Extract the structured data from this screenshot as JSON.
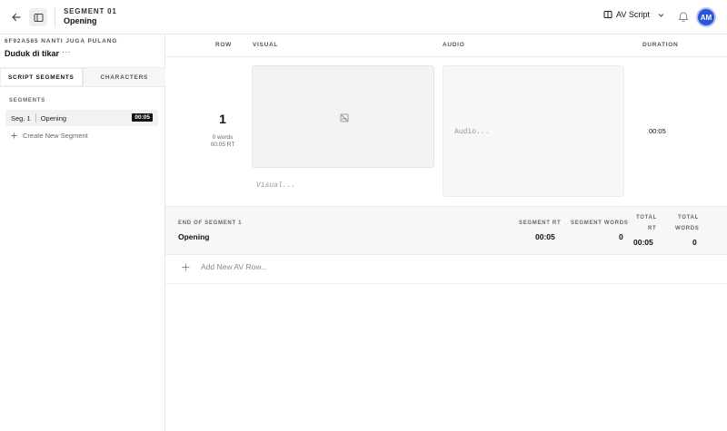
{
  "header": {
    "segment_eyebrow": "SEGMENT 01",
    "segment_title": "Opening",
    "view_label": "AV Script",
    "avatar_initials": "AM"
  },
  "sidebar": {
    "project_id": "6F92A585 NANTI JUGA PULANG",
    "project_name": "Duduk di tikar",
    "more_label": "···",
    "tabs": [
      {
        "label": "SCRIPT SEGMENTS",
        "active": true
      },
      {
        "label": "CHARACTERS",
        "active": false
      }
    ],
    "segments_heading": "SEGMENTS",
    "segments": [
      {
        "number": "Seg. 1",
        "title": "Opening",
        "duration": "00:05"
      }
    ],
    "create_label": "Create New Segment"
  },
  "table": {
    "columns": {
      "row": "ROW",
      "visual": "VISUAL",
      "audio": "AUDIO",
      "duration": "DURATION"
    },
    "rows": [
      {
        "number": "1",
        "words": "0 words",
        "rt": "00:05 RT",
        "visual_placeholder": "Visual...",
        "audio_placeholder": "Audio...",
        "duration": "00:05"
      }
    ]
  },
  "summary": {
    "end_label": "END OF SEGMENT 1",
    "segment_name": "Opening",
    "segment_rt_label": "SEGMENT RT",
    "segment_rt": "00:05",
    "segment_words_label": "SEGMENT WORDS",
    "segment_words": "0",
    "total_rt_label_1": "TOTAL",
    "total_rt_label_2": "RT",
    "total_rt": "00:05",
    "total_words_label_1": "TOTAL",
    "total_words_label_2": "WORDS",
    "total_words": "0"
  },
  "add_row_label": "Add New AV Row...",
  "colors": {
    "accent": "#2b56d8",
    "badge_bg": "#111111"
  }
}
